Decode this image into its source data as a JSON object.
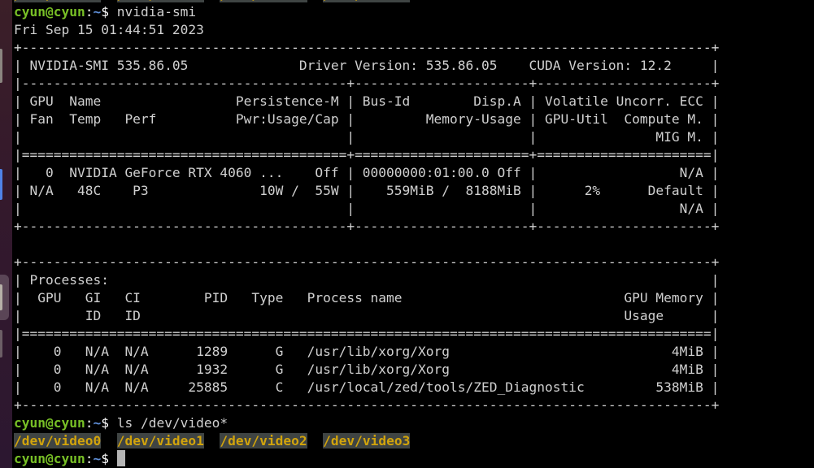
{
  "dock": {
    "apps": [
      "app-1",
      "app-2",
      "app-3-active",
      "app-4"
    ]
  },
  "terminal": {
    "prompt": {
      "user_host": "cyun@cyun",
      "separator": ":",
      "path": "~",
      "symbol": "$ "
    },
    "commands": [
      "nvidia-smi",
      "ls /dev/video*"
    ],
    "date_line": "Fri Sep 15 01:44:51 2023",
    "smi": {
      "border_top": "+---------------------------------------------------------------------------------------+",
      "header_line": "| NVIDIA-SMI 535.86.05              Driver Version: 535.86.05    CUDA Version: 12.2     |",
      "sep_1": "|-----------------------------------------+----------------------+----------------------+",
      "col_head_1": "| GPU  Name                 Persistence-M | Bus-Id        Disp.A | Volatile Uncorr. ECC |",
      "col_head_2": "| Fan  Temp   Perf          Pwr:Usage/Cap |         Memory-Usage | GPU-Util  Compute M. |",
      "col_head_3": "|                                         |                      |               MIG M. |",
      "sep_eq": "|=========================================+======================+======================|",
      "gpu_row_1": "|   0  NVIDIA GeForce RTX 4060 ...    Off | 00000000:01:00.0 Off |                  N/A |",
      "gpu_row_2": "| N/A   48C    P3              10W /  55W |    559MiB /  8188MiB |      2%      Default |",
      "gpu_row_3": "|                                         |                      |                  N/A |",
      "border_gpu_bottom": "+-----------------------------------------+----------------------+----------------------+",
      "blank": "",
      "proc_top": "+---------------------------------------------------------------------------------------+",
      "proc_title": "| Processes:                                                                            |",
      "proc_head_1": "|  GPU   GI   CI        PID   Type   Process name                            GPU Memory |",
      "proc_head_2": "|        ID   ID                                                             Usage      |",
      "proc_sep": "|=======================================================================================|",
      "proc_rows": [
        "|    0   N/A  N/A      1289      G   /usr/lib/xorg/Xorg                            4MiB |",
        "|    0   N/A  N/A      1932      G   /usr/lib/xorg/Xorg                            4MiB |",
        "|    0   N/A  N/A     25885      C   /usr/local/zed/tools/ZED_Diagnostic         538MiB |"
      ],
      "proc_bottom": "+---------------------------------------------------------------------------------------+",
      "values": {
        "smi_version": "535.86.05",
        "driver_version": "535.86.05",
        "cuda_version": "12.2",
        "gpu_index": "0",
        "gpu_name": "NVIDIA GeForce RTX 4060 ...",
        "persistence": "Off",
        "bus_id": "00000000:01:00.0",
        "disp_a": "Off",
        "ecc": "N/A",
        "fan": "N/A",
        "temp": "48C",
        "perf": "P3",
        "power_usage": "10W",
        "power_cap": "55W",
        "memory_used": "559MiB",
        "memory_total": "8188MiB",
        "gpu_util": "2%",
        "compute_mode": "Default",
        "mig_mode": "N/A"
      },
      "processes": [
        {
          "gpu": "0",
          "gi_id": "N/A",
          "ci_id": "N/A",
          "pid": "1289",
          "type": "G",
          "name": "/usr/lib/xorg/Xorg",
          "memory": "4MiB"
        },
        {
          "gpu": "0",
          "gi_id": "N/A",
          "ci_id": "N/A",
          "pid": "1932",
          "type": "G",
          "name": "/usr/lib/xorg/Xorg",
          "memory": "4MiB"
        },
        {
          "gpu": "0",
          "gi_id": "N/A",
          "ci_id": "N/A",
          "pid": "25885",
          "type": "C",
          "name": "/usr/local/zed/tools/ZED_Diagnostic",
          "memory": "538MiB"
        }
      ]
    },
    "ls_output": [
      "/dev/video0",
      "/dev/video1",
      "/dev/video2",
      "/dev/video3"
    ],
    "ls_gap": "  ",
    "colors": {
      "prompt_user": "#78c026",
      "prompt_path": "#5f8fd8",
      "device_text": "#d2a40c",
      "device_bg": "#3f4443",
      "text": "#d0d0d0",
      "background": "#000000",
      "dock_bg": "#34192c"
    }
  }
}
